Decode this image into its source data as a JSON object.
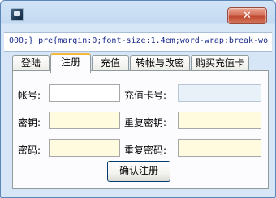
{
  "window": {
    "title": "",
    "close_glyph": "✕"
  },
  "address_bar": {
    "text": "000;} pre{margin:0;font-size:1.4em;word-wrap:break-wo"
  },
  "tabs": [
    {
      "label": "登陆",
      "active": false
    },
    {
      "label": "注册",
      "active": true
    },
    {
      "label": "充值",
      "active": false
    },
    {
      "label": "转帐与改密",
      "active": false
    },
    {
      "label": "购买充值卡",
      "active": false
    }
  ],
  "form": {
    "account_label": "帐号:",
    "account_value": "",
    "card_label": "充值卡号:",
    "card_value": "",
    "key_label": "密钥:",
    "key_value": "",
    "key_repeat_label": "重复密钥:",
    "key_repeat_value": "",
    "password_label": "密码:",
    "password_value": "",
    "password_repeat_label": "重复密码:",
    "password_repeat_value": "",
    "submit_label": "确认注册"
  },
  "colors": {
    "title_bar": "#c3d9f1",
    "close_button": "#c04930",
    "input_yellow": "#fffbdf",
    "input_disabled": "#e9f1f8",
    "active_tab_accent": "#f2b73c"
  }
}
